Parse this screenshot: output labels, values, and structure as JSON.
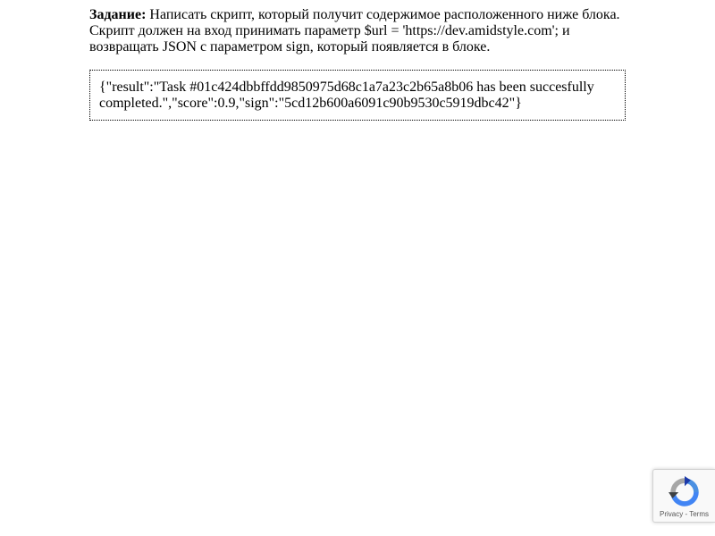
{
  "task": {
    "label": "Задание:",
    "text": " Написать скрипт, который получит содержимое расположенного ниже блока. Скрипт должен на вход принимать параметр $url = 'https://dev.amidstyle.com'; и возвращать JSON с параметром sign, который появляется в блоке."
  },
  "result_block": {
    "text": "{\"result\":\"Task #01c424dbbffdd9850975d68c1a7a23c2b65a8b06 has been succesfully completed.\",\"score\":0.9,\"sign\":\"5cd12b600a6091c90b9530c5919dbc42\"}"
  },
  "recaptcha": {
    "privacy_label": "Privacy",
    "separator": " - ",
    "terms_label": "Terms",
    "icon": "recaptcha-icon"
  }
}
